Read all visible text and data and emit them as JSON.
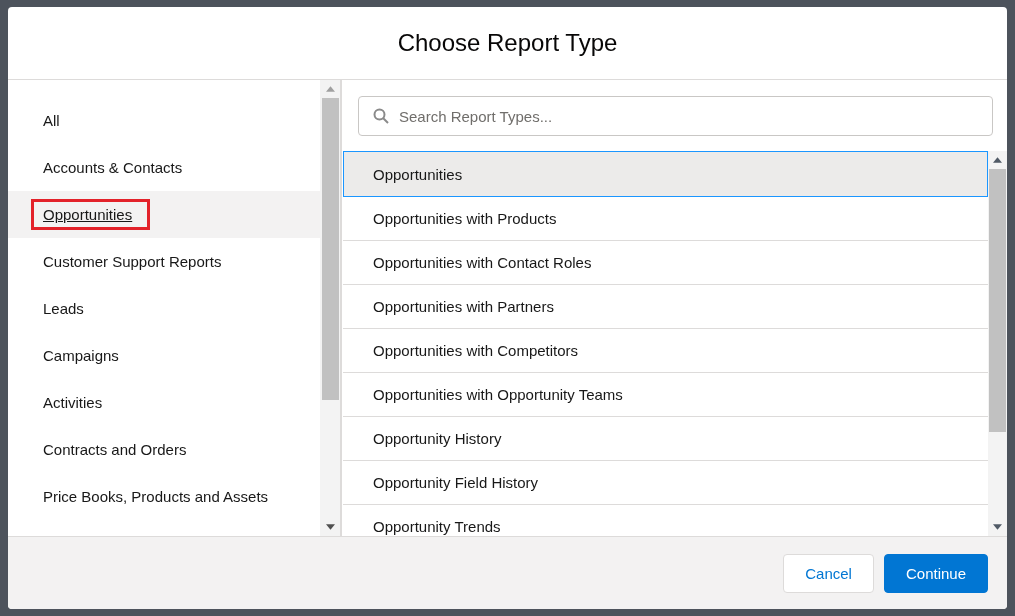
{
  "dialog": {
    "title": "Choose Report Type"
  },
  "categories": [
    {
      "label": "All",
      "selected": false,
      "highlighted": false
    },
    {
      "label": "Accounts & Contacts",
      "selected": false,
      "highlighted": false
    },
    {
      "label": "Opportunities",
      "selected": true,
      "highlighted": true
    },
    {
      "label": "Customer Support Reports",
      "selected": false,
      "highlighted": false
    },
    {
      "label": "Leads",
      "selected": false,
      "highlighted": false
    },
    {
      "label": "Campaigns",
      "selected": false,
      "highlighted": false
    },
    {
      "label": "Activities",
      "selected": false,
      "highlighted": false
    },
    {
      "label": "Contracts and Orders",
      "selected": false,
      "highlighted": false
    },
    {
      "label": "Price Books, Products and Assets",
      "selected": false,
      "highlighted": false
    }
  ],
  "search": {
    "placeholder": "Search Report Types..."
  },
  "report_types": [
    {
      "label": "Opportunities",
      "selected": true
    },
    {
      "label": "Opportunities with Products",
      "selected": false
    },
    {
      "label": "Opportunities with Contact Roles",
      "selected": false
    },
    {
      "label": "Opportunities with Partners",
      "selected": false
    },
    {
      "label": "Opportunities with Competitors",
      "selected": false
    },
    {
      "label": "Opportunities with Opportunity Teams",
      "selected": false
    },
    {
      "label": "Opportunity History",
      "selected": false
    },
    {
      "label": "Opportunity Field History",
      "selected": false
    },
    {
      "label": "Opportunity Trends",
      "selected": false
    }
  ],
  "buttons": [
    {
      "label": "Cancel",
      "kind": "neutral"
    },
    {
      "label": "Continue",
      "kind": "brand"
    }
  ]
}
